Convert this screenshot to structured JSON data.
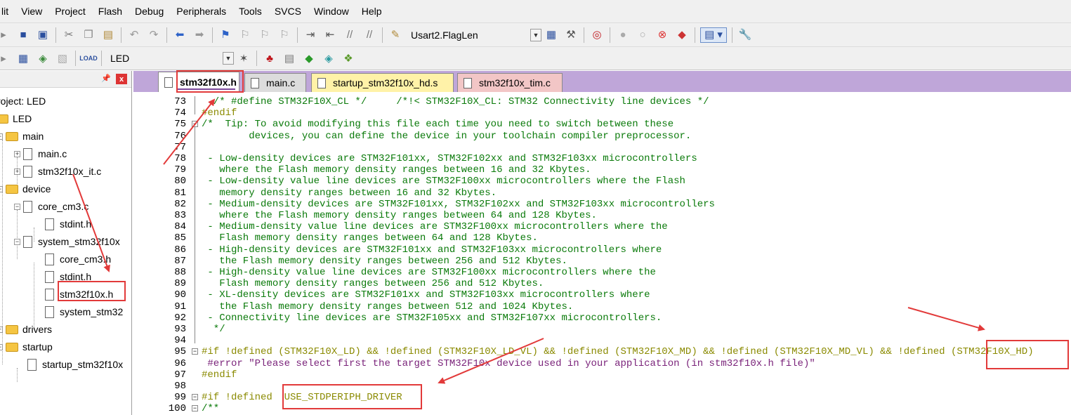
{
  "menu": [
    "lit",
    "View",
    "Project",
    "Flash",
    "Debug",
    "Peripherals",
    "Tools",
    "SVCS",
    "Window",
    "Help"
  ],
  "toolbar1": {
    "target_combo": "Usart2.FlagLen"
  },
  "toolbar2": {
    "target_combo": "LED"
  },
  "project_panel": {
    "project_label": "roject: LED",
    "tree": [
      {
        "label": "LED",
        "type": "folder"
      },
      {
        "label": "main",
        "type": "folder"
      },
      {
        "label": "main.c",
        "type": "file"
      },
      {
        "label": "stm32f10x_it.c",
        "type": "file"
      },
      {
        "label": "device",
        "type": "folder"
      },
      {
        "label": "core_cm3.c",
        "type": "file"
      },
      {
        "label": "stdint.h",
        "type": "file"
      },
      {
        "label": "system_stm32f10x",
        "type": "file"
      },
      {
        "label": "core_cm3.h",
        "type": "file"
      },
      {
        "label": "stdint.h",
        "type": "file"
      },
      {
        "label": "stm32f10x.h",
        "type": "file"
      },
      {
        "label": "system_stm32",
        "type": "file"
      },
      {
        "label": "drivers",
        "type": "folder"
      },
      {
        "label": "startup",
        "type": "folder"
      },
      {
        "label": "startup_stm32f10x",
        "type": "file"
      }
    ]
  },
  "tabs": [
    {
      "label": "stm32f10x.h",
      "active": true,
      "color": "#ffffff"
    },
    {
      "label": "main.c",
      "active": false,
      "color": "#dcdcdc"
    },
    {
      "label": "startup_stm32f10x_hd.s",
      "active": false,
      "color": "#fff2a8"
    },
    {
      "label": "stm32f10x_tim.c",
      "active": false,
      "color": "#f2c6c6"
    }
  ],
  "code_lines": [
    {
      "n": "73",
      "text": "  /* #define STM32F10X_CL */     /*!< STM32F10X_CL: STM32 Connectivity line devices */"
    },
    {
      "n": "74",
      "text": "#endif"
    },
    {
      "n": "75",
      "text": "/*  Tip: To avoid modifying this file each time you need to switch between these"
    },
    {
      "n": "76",
      "text": "        devices, you can define the device in your toolchain compiler preprocessor."
    },
    {
      "n": "77",
      "text": ""
    },
    {
      "n": "78",
      "text": " - Low-density devices are STM32F101xx, STM32F102xx and STM32F103xx microcontrollers"
    },
    {
      "n": "79",
      "text": "   where the Flash memory density ranges between 16 and 32 Kbytes."
    },
    {
      "n": "80",
      "text": " - Low-density value line devices are STM32F100xx microcontrollers where the Flash"
    },
    {
      "n": "81",
      "text": "   memory density ranges between 16 and 32 Kbytes."
    },
    {
      "n": "82",
      "text": " - Medium-density devices are STM32F101xx, STM32F102xx and STM32F103xx microcontrollers"
    },
    {
      "n": "83",
      "text": "   where the Flash memory density ranges between 64 and 128 Kbytes."
    },
    {
      "n": "84",
      "text": " - Medium-density value line devices are STM32F100xx microcontrollers where the"
    },
    {
      "n": "85",
      "text": "   Flash memory density ranges between 64 and 128 Kbytes."
    },
    {
      "n": "86",
      "text": " - High-density devices are STM32F101xx and STM32F103xx microcontrollers where"
    },
    {
      "n": "87",
      "text": "   the Flash memory density ranges between 256 and 512 Kbytes."
    },
    {
      "n": "88",
      "text": " - High-density value line devices are STM32F100xx microcontrollers where the"
    },
    {
      "n": "89",
      "text": "   Flash memory density ranges between 256 and 512 Kbytes."
    },
    {
      "n": "90",
      "text": " - XL-density devices are STM32F101xx and STM32F103xx microcontrollers where"
    },
    {
      "n": "91",
      "text": "   the Flash memory density ranges between 512 and 1024 Kbytes."
    },
    {
      "n": "92",
      "text": " - Connectivity line devices are STM32F105xx and STM32F107xx microcontrollers."
    },
    {
      "n": "93",
      "text": "  */"
    },
    {
      "n": "94",
      "text": ""
    },
    {
      "n": "95",
      "text": "#if !defined (STM32F10X_LD) && !defined (STM32F10X_LD_VL) && !defined (STM32F10X_MD) && !defined (STM32F10X_MD_VL) && !defined (STM32F10X_HD)"
    },
    {
      "n": "96",
      "text": " #error \"Please select first the target STM32F10x device used in your application (in stm32f10x.h file)\""
    },
    {
      "n": "97",
      "text": "#endif"
    },
    {
      "n": "98",
      "text": ""
    },
    {
      "n": "99",
      "text": "#if !defined  USE_STDPERIPH_DRIVER"
    },
    {
      "n": "100",
      "text": "/**"
    }
  ]
}
